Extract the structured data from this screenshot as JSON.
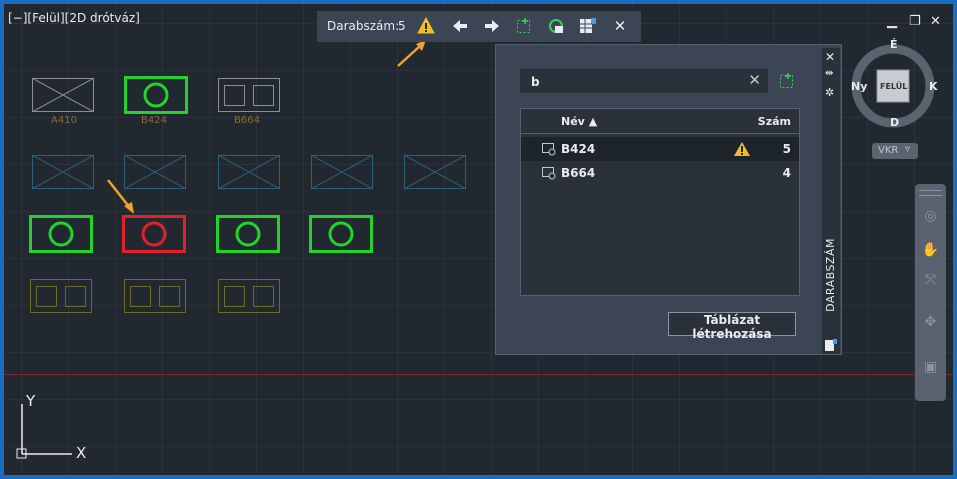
{
  "viewport": {
    "label": "[−][Felül][2D drótváz]"
  },
  "window_controls": {
    "minimize": "▁",
    "restore": "❐",
    "close": "✕"
  },
  "count_toolbar": {
    "label": "Darabszám:",
    "count": "5"
  },
  "palette": {
    "search_value": "b",
    "col_name": "Név",
    "col_count": "Szám",
    "rows": [
      {
        "name": "B424",
        "count": "5",
        "warning": true,
        "selected": true
      },
      {
        "name": "B664",
        "count": "4",
        "warning": false,
        "selected": false
      }
    ],
    "create_table_label": "Táblázat létrehozása",
    "vertical_title": "DARABSZÁM"
  },
  "drawing_labels": {
    "a410": "A410",
    "b424": "B424",
    "b664": "B664"
  },
  "viewcube": {
    "north": "É",
    "south": "D",
    "west": "Ny",
    "east": "K",
    "face": "FELÜL",
    "ucs_label": "VKR"
  },
  "ucs": {
    "y": "Y",
    "x": "X"
  },
  "colors": {
    "accent": "#f0a030",
    "block_green": "#22d42a",
    "block_red": "#e0202a",
    "frame_blue": "#1b6dc2"
  }
}
